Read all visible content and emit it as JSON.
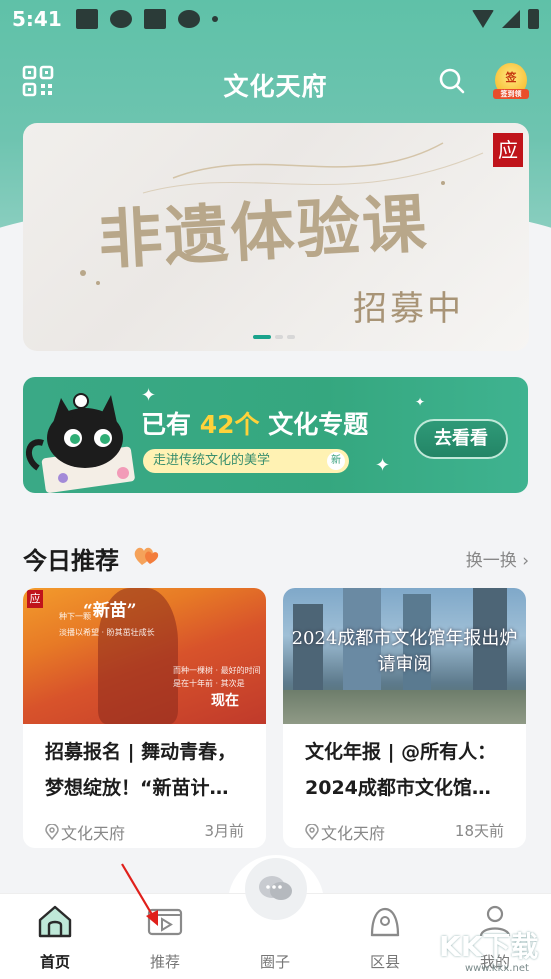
{
  "status_bar": {
    "time": "5:41"
  },
  "header": {
    "title": "文化天府",
    "sign_badge_text": "签",
    "sign_badge_sub": "签到领"
  },
  "banner": {
    "title": "非遗体验课",
    "subtitle": "招募中",
    "seal_char": "应",
    "slide_count": 3,
    "active_slide": 0
  },
  "topic_card": {
    "prefix": "已有",
    "count": "42个",
    "suffix": "文化专题",
    "tagline": "走进传统文化的美学",
    "new_badge": "新",
    "button_label": "去看看"
  },
  "today": {
    "title": "今日推荐",
    "refresh_label": "换一换 ›",
    "cards": [
      {
        "title": "招募报名 | 舞动青春，梦想绽放！“新苗计…",
        "source": "文化天府",
        "time": "3月前",
        "image_text_1": "“新苗”",
        "image_text_2": "种下一颗",
        "image_text_3": "淡播以希望 · 盼其茁壮成长",
        "image_text_4": "而种一棵树 · 最好的时间是在十年前 · 其次是",
        "image_text_5": "现在",
        "seal": "应"
      },
      {
        "title": "文化年报 | @所有人：2024成都市文化馆…",
        "source": "文化天府",
        "time": "18天前",
        "image_text_1": "2024成都市文化馆年报出炉",
        "image_text_2": "请审阅"
      }
    ]
  },
  "bottom_nav": {
    "items": [
      {
        "label": "首页",
        "icon": "home-icon",
        "active": true
      },
      {
        "label": "推荐",
        "icon": "video-icon",
        "active": false
      },
      {
        "label": "圈子",
        "icon": "chat-bubble-icon",
        "active": false
      },
      {
        "label": "区县",
        "icon": "location-pin-icon",
        "active": false
      },
      {
        "label": "我的",
        "icon": "user-icon",
        "active": false
      }
    ]
  },
  "watermark": {
    "text": "KK下载",
    "url": "www.kkx.net"
  },
  "colors": {
    "brand_green": "#5fc1a8",
    "topic_green": "#35a77f",
    "highlight_yellow": "#ffd23a",
    "seal_red": "#c0141b"
  }
}
